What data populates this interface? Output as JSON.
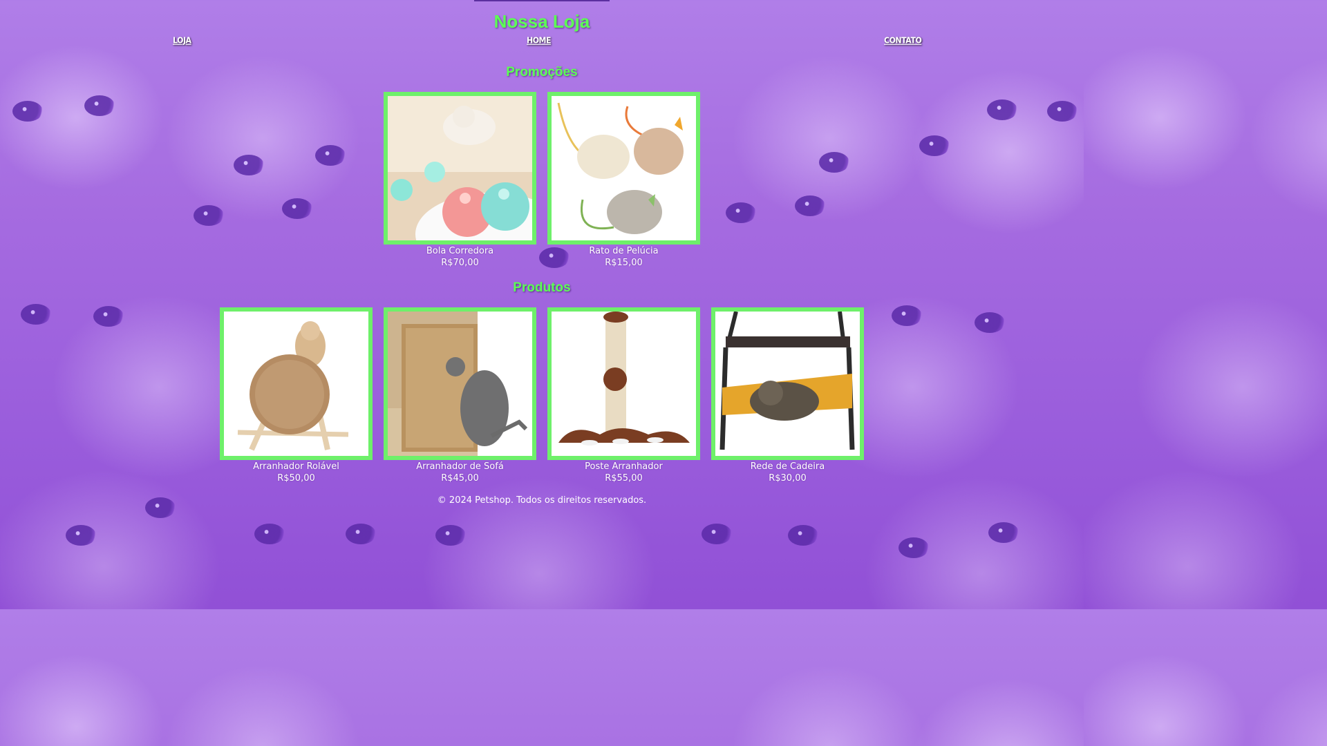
{
  "header": {
    "title": "Nossa Loja",
    "nav": [
      "LOJA",
      "HOME",
      "CONTATO"
    ]
  },
  "promocoes": {
    "title": "Promoções",
    "items": [
      {
        "name": "Bola Corredora",
        "price": "R$70,00",
        "image": "rolling-ball-toy"
      },
      {
        "name": "Rato de Pelúcia",
        "price": "R$15,00",
        "image": "plush-mice-toys"
      }
    ]
  },
  "produtos": {
    "title": "Produtos",
    "items": [
      {
        "name": "Arranhador Rolável",
        "price": "R$50,00",
        "image": "rolling-scratcher"
      },
      {
        "name": "Arranhador de Sofá",
        "price": "R$45,00",
        "image": "sofa-scratcher"
      },
      {
        "name": "Poste Arranhador",
        "price": "R$55,00",
        "image": "scratching-post"
      },
      {
        "name": "Rede de Cadeira",
        "price": "R$30,00",
        "image": "chair-hammock"
      }
    ]
  },
  "footer": {
    "text": "© 2024 Petshop. Todos os direitos reservados."
  },
  "colors": {
    "accent_green": "#5dff55",
    "frame_green": "#6ef06a",
    "background_purple": "#a56be0"
  }
}
